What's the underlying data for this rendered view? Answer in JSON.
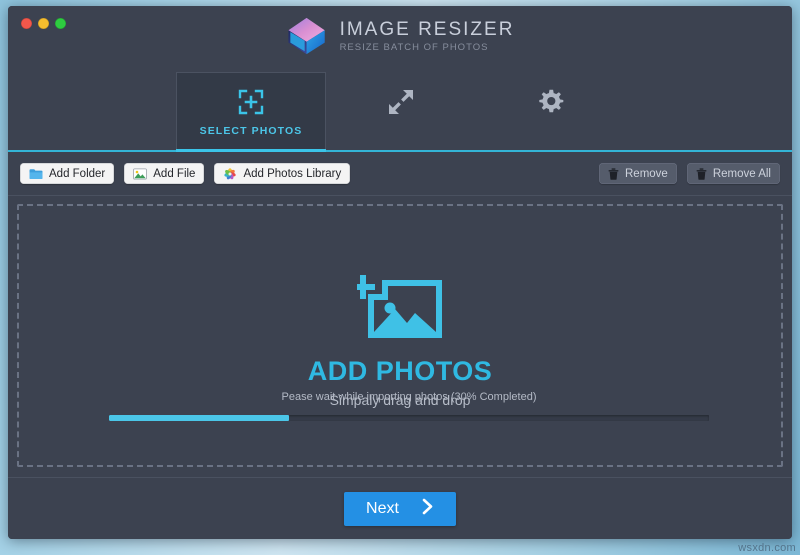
{
  "window": {
    "traffic_lights": [
      {
        "name": "close",
        "color": "#f2574b"
      },
      {
        "name": "minimize",
        "color": "#f5bd2e"
      },
      {
        "name": "maximize",
        "color": "#2ecc40"
      }
    ]
  },
  "header": {
    "logo_icon": "diamond-cube-logo-icon",
    "title": "IMAGE RESIZER",
    "subtitle": "RESIZE BATCH OF PHOTOS"
  },
  "tabs": [
    {
      "id": "select-photos",
      "label": "SELECT PHOTOS",
      "icon": "crop-frame-plus-icon",
      "active": true
    },
    {
      "id": "resize",
      "label": "",
      "icon": "resize-diagonal-arrows-icon",
      "active": false
    },
    {
      "id": "settings",
      "label": "",
      "icon": "gear-icon",
      "active": false
    }
  ],
  "toolbar": {
    "left_buttons": [
      {
        "id": "add-folder",
        "label": "Add Folder",
        "icon": "folder-icon",
        "style": "light"
      },
      {
        "id": "add-file",
        "label": "Add File",
        "icon": "picture-icon",
        "style": "light"
      },
      {
        "id": "add-photos-library",
        "label": "Add Photos Library",
        "icon": "photos-app-icon",
        "style": "light"
      }
    ],
    "right_buttons": [
      {
        "id": "remove",
        "label": "Remove",
        "icon": "trash-icon",
        "style": "dark"
      },
      {
        "id": "remove-all",
        "label": "Remove All",
        "icon": "trash-icon",
        "style": "dark"
      }
    ]
  },
  "dropzone": {
    "icon": "add-photo-icon",
    "title": "ADD PHOTOS",
    "subtitle": "Simpaly drag and drop",
    "accent_color": "#2fb9e2"
  },
  "progress": {
    "label": "Pease wait while importing photos (30% Completed)",
    "percent": 30,
    "percent_css": "30%",
    "fill_color": "#4bc6e8"
  },
  "footer": {
    "next_label": "Next",
    "next_icon": "chevron-right-icon",
    "next_color": "#2490e4"
  },
  "watermark": {
    "text": "wsxdn.com"
  }
}
